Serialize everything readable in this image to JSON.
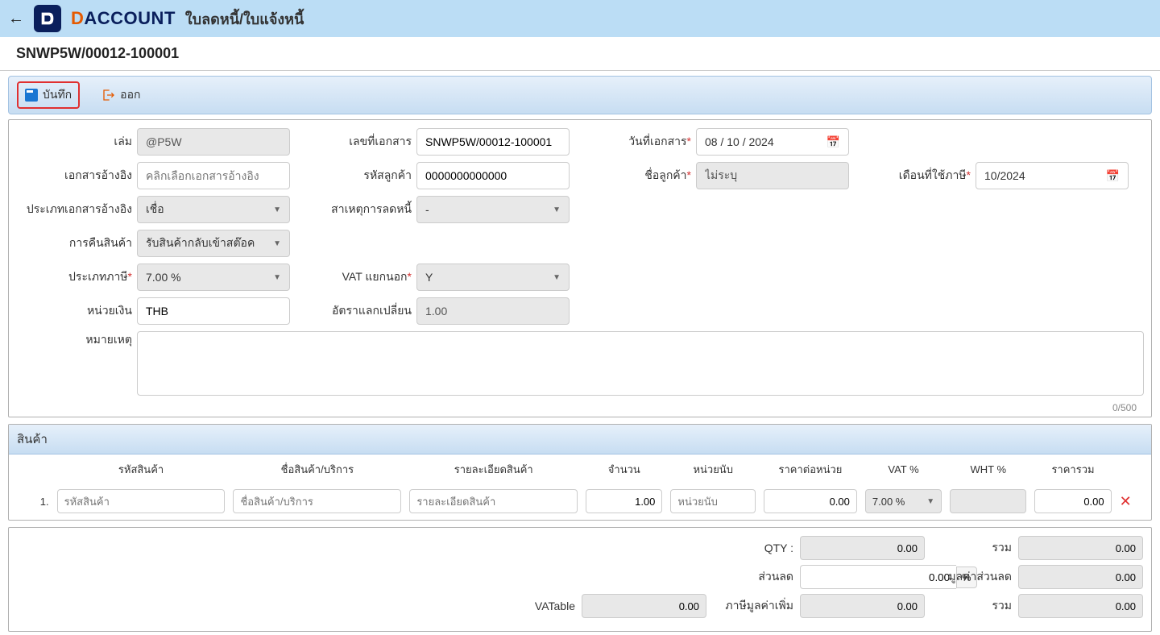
{
  "header": {
    "brand_pre": "D",
    "brand_rest": "ACCOUNT",
    "page_title": "ใบลดหนี้/ใบแจ้งหนี้",
    "doc_number": "SNWP5W/00012-100001"
  },
  "toolbar": {
    "save": "บันทึก",
    "exit": "ออก"
  },
  "form": {
    "book": {
      "label": "เล่ม",
      "value": "@P5W"
    },
    "doc_no": {
      "label": "เลขที่เอกสาร",
      "value": "SNWP5W/00012-100001"
    },
    "doc_date": {
      "label": "วันที่เอกสาร",
      "value": "08 / 10 / 2024"
    },
    "ref_doc": {
      "label": "เอกสารอ้างอิง",
      "placeholder": "คลิกเลือกเอกสารอ้างอิง"
    },
    "cust_code": {
      "label": "รหัสลูกค้า",
      "value": "0000000000000"
    },
    "cust_name": {
      "label": "ชื่อลูกค้า",
      "value": "ไม่ระบุ"
    },
    "tax_month": {
      "label": "เดือนที่ใช้ภาษี",
      "value": "10/2024"
    },
    "ref_type": {
      "label": "ประเภทเอกสารอ้างอิง",
      "value": "เชื่อ"
    },
    "debit_reason": {
      "label": "สาเหตุการลดหนี้",
      "value": "-"
    },
    "return_goods": {
      "label": "การคืนสินค้า",
      "value": "รับสินค้ากลับเข้าสต๊อค"
    },
    "tax_type": {
      "label": "ประเภทภาษี",
      "value": "7.00 %"
    },
    "vat_exclude": {
      "label": "VAT แยกนอก",
      "value": "Y"
    },
    "currency": {
      "label": "หน่วยเงิน",
      "value": "THB"
    },
    "exchange_rate": {
      "label": "อัตราแลกเปลี่ยน",
      "value": "1.00"
    },
    "remarks": {
      "label": "หมายเหตุ",
      "char_count": "0/500"
    }
  },
  "products": {
    "section_title": "สินค้า",
    "headers": {
      "code": "รหัสสินค้า",
      "name": "ชื่อสินค้า/บริการ",
      "desc": "รายละเอียดสินค้า",
      "qty": "จำนวน",
      "unit": "หน่วยนับ",
      "price": "ราคาต่อหน่วย",
      "vat": "VAT %",
      "wht": "WHT %",
      "total": "ราคารวม"
    },
    "row": {
      "index": "1.",
      "code_ph": "รหัสสินค้า",
      "name_ph": "ชื่อสินค้า/บริการ",
      "desc_ph": "รายละเอียดสินค้า",
      "qty": "1.00",
      "unit_ph": "หน่วยนับ",
      "price": "0.00",
      "vat": "7.00 %",
      "total": "0.00"
    }
  },
  "totals": {
    "qty": {
      "label": "QTY :",
      "value": "0.00"
    },
    "sum": {
      "label": "รวม",
      "value": "0.00"
    },
    "discount": {
      "label": "ส่วนลด",
      "value": "0.00",
      "pct": "%"
    },
    "discount_amt": {
      "label": "มูลค่าส่วนลด",
      "value": "0.00"
    },
    "vatable": {
      "label": "VATable",
      "value": "0.00"
    },
    "vat_amt": {
      "label": "ภาษีมูลค่าเพิ่ม",
      "value": "0.00"
    },
    "sum2": {
      "label": "รวม",
      "value": "0.00"
    }
  }
}
